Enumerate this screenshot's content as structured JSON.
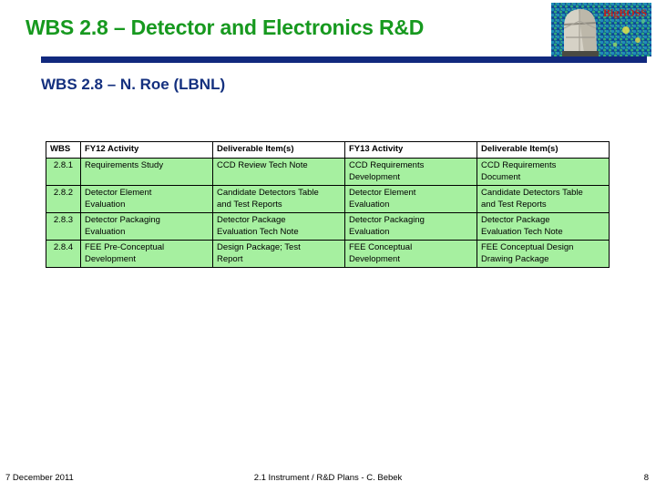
{
  "slide": {
    "title": "WBS 2.8 – Detector and Electronics R&D",
    "subtitle": "WBS 2.8 – N. Roe (LBNL)",
    "title_color": "#17991f",
    "subtitle_color": "#14307f",
    "divider_color": "#11297e",
    "cell_fill_color": "#a6f0a0"
  },
  "logo": {
    "name": "bigboss-logo",
    "text": "BigBOSS",
    "text_color": "#c0201c",
    "background_colors": [
      "#0f3a8a",
      "#1f7fa8",
      "#2fae6a",
      "#d8d84a"
    ],
    "dome_color": "#d8d4c8"
  },
  "table": {
    "headers": [
      "WBS",
      "FY12 Activity",
      "Deliverable Item(s)",
      "FY13 Activity",
      "Deliverable Item(s)"
    ],
    "rows": [
      {
        "wbs": "2.8.1",
        "fy12_activity": [
          "Requirements Study"
        ],
        "fy12_deliverable": [
          "CCD Review Tech Note"
        ],
        "fy13_activity": [
          "CCD Requirements",
          "Development"
        ],
        "fy13_deliverable": [
          "CCD Requirements",
          "Document"
        ]
      },
      {
        "wbs": "2.8.2",
        "fy12_activity": [
          "Detector Element",
          "Evaluation"
        ],
        "fy12_deliverable": [
          "Candidate Detectors Table",
          "and Test Reports"
        ],
        "fy13_activity": [
          "Detector Element",
          "Evaluation"
        ],
        "fy13_deliverable": [
          "Candidate Detectors Table",
          "and Test Reports"
        ]
      },
      {
        "wbs": "2.8.3",
        "fy12_activity": [
          "Detector Packaging",
          "Evaluation"
        ],
        "fy12_deliverable": [
          "Detector Package",
          "Evaluation Tech Note"
        ],
        "fy13_activity": [
          "Detector Packaging",
          "Evaluation"
        ],
        "fy13_deliverable": [
          "Detector Package",
          "Evaluation Tech Note"
        ]
      },
      {
        "wbs": "2.8.4",
        "fy12_activity": [
          "FEE Pre-Conceptual",
          "Development"
        ],
        "fy12_deliverable": [
          "Design Package; Test",
          "Report"
        ],
        "fy13_activity": [
          "FEE Conceptual",
          "Development"
        ],
        "fy13_deliverable": [
          "FEE Conceptual Design",
          "Drawing Package"
        ]
      }
    ]
  },
  "footer": {
    "date": "7 December 2011",
    "center": "2.1  Instrument / R&D Plans - C. Bebek",
    "page": "8"
  }
}
